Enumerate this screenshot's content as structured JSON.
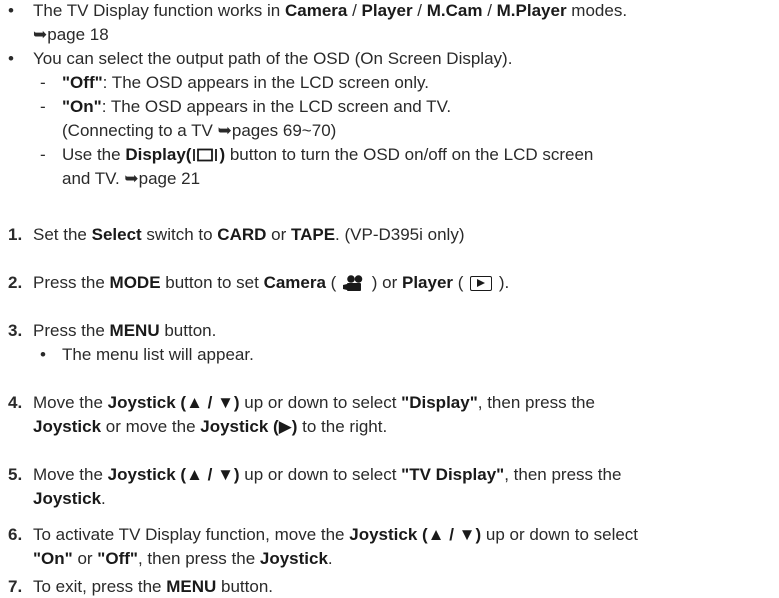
{
  "notes": {
    "b1": {
      "pre": "The TV Display function works in ",
      "m1": "Camera",
      "s1": " / ",
      "m2": "Player",
      "s2": " / ",
      "m3": "M.Cam",
      "s3": " / ",
      "m4": "M.Player",
      "post": " modes.",
      "ref": "page 18"
    },
    "b2": {
      "text": "You can select the output path of the OSD (On Screen Display)."
    },
    "off": {
      "key": "\"Off\"",
      "text": ": The OSD appears in the LCD screen only."
    },
    "on": {
      "key": "\"On\"",
      "text": ": The OSD appears in the LCD screen and TV.",
      "cont_pre": "(Connecting to a TV ",
      "cont_ref": "pages 69~70",
      "cont_post": ")"
    },
    "use": {
      "pre": "Use the ",
      "btn": "Display(",
      "btn_close": ")",
      "post": " button to turn the OSD on/off on the LCD screen",
      "cont_pre": "and TV. ",
      "ref": "page 21"
    }
  },
  "steps": [
    {
      "num": "1.",
      "a": "Set the ",
      "b1": "Select",
      "c": " switch to ",
      "b2": "CARD",
      "d": " or ",
      "b3": "TAPE",
      "e": ". (VP-D395i only)"
    },
    {
      "num": "2.",
      "a": "Press the ",
      "b1": "MODE",
      "c": " button to set ",
      "b2": "Camera",
      "d": " ( ",
      "e": " ) or ",
      "b3": "Player",
      "f": " ( ",
      "g": " )."
    },
    {
      "num": "3.",
      "a": "Press the ",
      "b1": "MENU",
      "c": " button.",
      "sub": "The menu list will appear."
    },
    {
      "num": "4.",
      "a": "Move the ",
      "b1": "Joystick (▲ / ▼)",
      "c": " up or down to select ",
      "b2": "\"Display\"",
      "d": ", then press the",
      "l2b1": "Joystick",
      "l2c": " or move the ",
      "l2b2": "Joystick (▶)",
      "l2d": " to the right."
    },
    {
      "num": "5.",
      "a": "Move the ",
      "b1": "Joystick (▲ / ▼)",
      "c": " up or down to select ",
      "b2": "\"TV Display\"",
      "d": ", then press the",
      "l2b1": "Joystick",
      "l2c": "."
    },
    {
      "num": "6.",
      "a": "To activate TV Display function, move the ",
      "b1": "Joystick (▲ / ▼)",
      "c": " up or down to select",
      "l2b1": "\"On\"",
      "l2c": " or ",
      "l2b2": "\"Off\"",
      "l2d": ", then press the ",
      "l2b3": "Joystick",
      "l2e": "."
    },
    {
      "num": "7.",
      "a": "To exit, press the ",
      "b1": "MENU",
      "c": " button."
    }
  ],
  "glyphs": {
    "bullet": "•",
    "dash": "-",
    "arrow": "➥"
  },
  "icons": [
    "camera-mode-icon",
    "player-mode-icon",
    "display-button-icon",
    "page-reference-arrow-icon"
  ]
}
